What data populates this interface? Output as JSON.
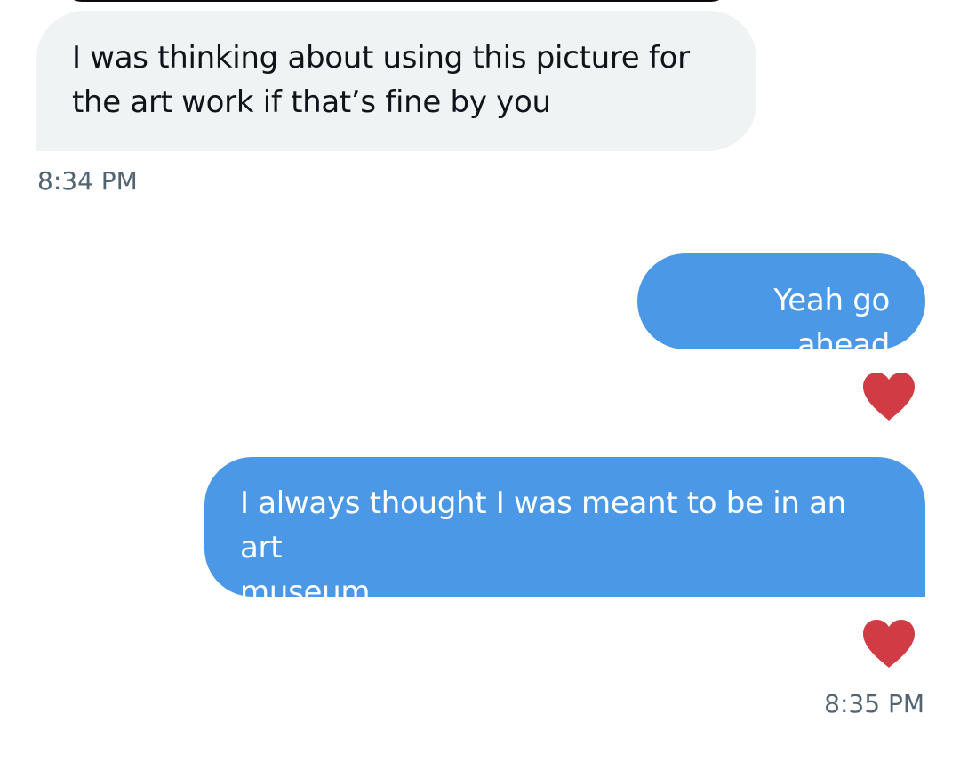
{
  "conversation": {
    "messages": [
      {
        "direction": "received",
        "text": "I was thinking about using this picture for\nthe art work if that’s fine by you"
      },
      {
        "direction": "sent",
        "text": "Yeah go ahead",
        "reaction": "red-heart-icon"
      },
      {
        "direction": "sent",
        "text": "I always thought I was meant to be in an art\nmuseum",
        "reaction": "red-heart-icon"
      }
    ],
    "timestamps": [
      "8:34 PM",
      "8:35 PM"
    ]
  },
  "colors": {
    "received_bubble": "#eff3f4",
    "sent_bubble": "#4b98e6",
    "heart": "#d13b44",
    "timestamp_text": "#536471"
  }
}
